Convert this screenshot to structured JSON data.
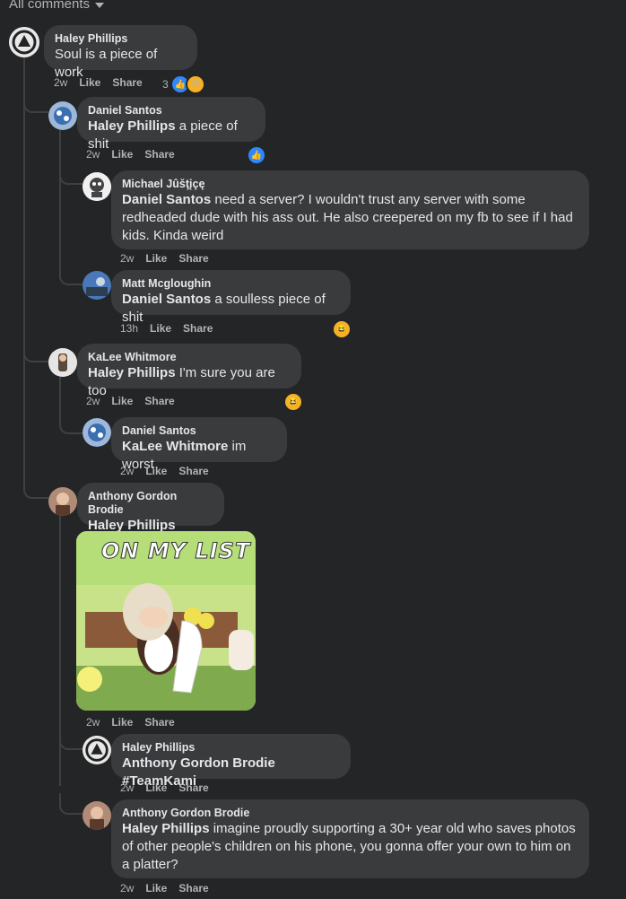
{
  "filter": {
    "label": "All comments"
  },
  "actions": {
    "like": "Like",
    "share": "Share"
  },
  "comments": [
    {
      "author": "Haley Phillips",
      "text": "Soul is a piece of work",
      "time": "2w",
      "reaction_count": "3"
    },
    {
      "author": "Daniel Santos",
      "tag": "Haley Phillips",
      "text": " a piece of shit",
      "time": "2w"
    },
    {
      "author": "Michael Jûšţįçę",
      "tag": "Daniel Santos",
      "text": " need a server? I wouldn't trust any server with some redheaded dude with his ass out. He also creepered on my fb to see if I had kids. Kinda weird",
      "time": "2w"
    },
    {
      "author": "Matt Mcgloughin",
      "tag": "Daniel Santos",
      "text": " a soulless piece of shit",
      "time": "13h"
    },
    {
      "author": "KaLee Whitmore",
      "tag": "Haley Phillips",
      "text": " I'm sure you are too",
      "time": "2w"
    },
    {
      "author": "Daniel Santos",
      "tag": "KaLee Whitmore",
      "text": " im worst",
      "time": "2w"
    },
    {
      "author": "Anthony Gordon Brodie",
      "tag": "Haley Phillips",
      "text": "",
      "time": "2w",
      "gif_caption": "ON MY LIST"
    },
    {
      "author": "Haley Phillips",
      "tag": "Anthony Gordon Brodie",
      "text": " #TeamKami",
      "time": "2w"
    },
    {
      "author": "Anthony Gordon Brodie",
      "tag": "Haley Phillips",
      "text": " imagine proudly supporting a 30+ year old who saves photos of other people's children on his phone, you gonna offer your own to him on a platter?",
      "time": "2w"
    }
  ],
  "colors": {
    "background": "#242526",
    "bubble": "#3a3b3c",
    "text": "#e4e6eb",
    "muted": "#b0b3b8",
    "like": "#2d88ff",
    "haha": "#f7b125"
  }
}
